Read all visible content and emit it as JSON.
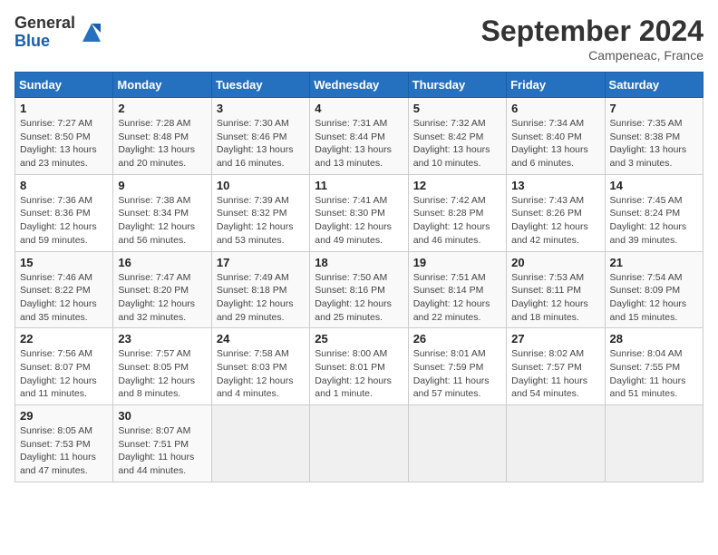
{
  "header": {
    "logo_general": "General",
    "logo_blue": "Blue",
    "month_title": "September 2024",
    "location": "Campeneac, France"
  },
  "calendar": {
    "days_of_week": [
      "Sunday",
      "Monday",
      "Tuesday",
      "Wednesday",
      "Thursday",
      "Friday",
      "Saturday"
    ],
    "weeks": [
      [
        {
          "day": "",
          "info": ""
        },
        {
          "day": "2",
          "info": "Sunrise: 7:28 AM\nSunset: 8:48 PM\nDaylight: 13 hours\nand 20 minutes."
        },
        {
          "day": "3",
          "info": "Sunrise: 7:30 AM\nSunset: 8:46 PM\nDaylight: 13 hours\nand 16 minutes."
        },
        {
          "day": "4",
          "info": "Sunrise: 7:31 AM\nSunset: 8:44 PM\nDaylight: 13 hours\nand 13 minutes."
        },
        {
          "day": "5",
          "info": "Sunrise: 7:32 AM\nSunset: 8:42 PM\nDaylight: 13 hours\nand 10 minutes."
        },
        {
          "day": "6",
          "info": "Sunrise: 7:34 AM\nSunset: 8:40 PM\nDaylight: 13 hours\nand 6 minutes."
        },
        {
          "day": "7",
          "info": "Sunrise: 7:35 AM\nSunset: 8:38 PM\nDaylight: 13 hours\nand 3 minutes."
        }
      ],
      [
        {
          "day": "1",
          "info": "Sunrise: 7:27 AM\nSunset: 8:50 PM\nDaylight: 13 hours\nand 23 minutes."
        },
        {
          "day": "9",
          "info": "Sunrise: 7:38 AM\nSunset: 8:34 PM\nDaylight: 12 hours\nand 56 minutes."
        },
        {
          "day": "10",
          "info": "Sunrise: 7:39 AM\nSunset: 8:32 PM\nDaylight: 12 hours\nand 53 minutes."
        },
        {
          "day": "11",
          "info": "Sunrise: 7:41 AM\nSunset: 8:30 PM\nDaylight: 12 hours\nand 49 minutes."
        },
        {
          "day": "12",
          "info": "Sunrise: 7:42 AM\nSunset: 8:28 PM\nDaylight: 12 hours\nand 46 minutes."
        },
        {
          "day": "13",
          "info": "Sunrise: 7:43 AM\nSunset: 8:26 PM\nDaylight: 12 hours\nand 42 minutes."
        },
        {
          "day": "14",
          "info": "Sunrise: 7:45 AM\nSunset: 8:24 PM\nDaylight: 12 hours\nand 39 minutes."
        }
      ],
      [
        {
          "day": "8",
          "info": "Sunrise: 7:36 AM\nSunset: 8:36 PM\nDaylight: 12 hours\nand 59 minutes."
        },
        {
          "day": "16",
          "info": "Sunrise: 7:47 AM\nSunset: 8:20 PM\nDaylight: 12 hours\nand 32 minutes."
        },
        {
          "day": "17",
          "info": "Sunrise: 7:49 AM\nSunset: 8:18 PM\nDaylight: 12 hours\nand 29 minutes."
        },
        {
          "day": "18",
          "info": "Sunrise: 7:50 AM\nSunset: 8:16 PM\nDaylight: 12 hours\nand 25 minutes."
        },
        {
          "day": "19",
          "info": "Sunrise: 7:51 AM\nSunset: 8:14 PM\nDaylight: 12 hours\nand 22 minutes."
        },
        {
          "day": "20",
          "info": "Sunrise: 7:53 AM\nSunset: 8:11 PM\nDaylight: 12 hours\nand 18 minutes."
        },
        {
          "day": "21",
          "info": "Sunrise: 7:54 AM\nSunset: 8:09 PM\nDaylight: 12 hours\nand 15 minutes."
        }
      ],
      [
        {
          "day": "15",
          "info": "Sunrise: 7:46 AM\nSunset: 8:22 PM\nDaylight: 12 hours\nand 35 minutes."
        },
        {
          "day": "23",
          "info": "Sunrise: 7:57 AM\nSunset: 8:05 PM\nDaylight: 12 hours\nand 8 minutes."
        },
        {
          "day": "24",
          "info": "Sunrise: 7:58 AM\nSunset: 8:03 PM\nDaylight: 12 hours\nand 4 minutes."
        },
        {
          "day": "25",
          "info": "Sunrise: 8:00 AM\nSunset: 8:01 PM\nDaylight: 12 hours\nand 1 minute."
        },
        {
          "day": "26",
          "info": "Sunrise: 8:01 AM\nSunset: 7:59 PM\nDaylight: 11 hours\nand 57 minutes."
        },
        {
          "day": "27",
          "info": "Sunrise: 8:02 AM\nSunset: 7:57 PM\nDaylight: 11 hours\nand 54 minutes."
        },
        {
          "day": "28",
          "info": "Sunrise: 8:04 AM\nSunset: 7:55 PM\nDaylight: 11 hours\nand 51 minutes."
        }
      ],
      [
        {
          "day": "22",
          "info": "Sunrise: 7:56 AM\nSunset: 8:07 PM\nDaylight: 12 hours\nand 11 minutes."
        },
        {
          "day": "30",
          "info": "Sunrise: 8:07 AM\nSunset: 7:51 PM\nDaylight: 11 hours\nand 44 minutes."
        },
        {
          "day": "",
          "info": ""
        },
        {
          "day": "",
          "info": ""
        },
        {
          "day": "",
          "info": ""
        },
        {
          "day": "",
          "info": ""
        },
        {
          "day": "",
          "info": ""
        }
      ],
      [
        {
          "day": "29",
          "info": "Sunrise: 8:05 AM\nSunset: 7:53 PM\nDaylight: 11 hours\nand 47 minutes."
        },
        {
          "day": "",
          "info": ""
        },
        {
          "day": "",
          "info": ""
        },
        {
          "day": "",
          "info": ""
        },
        {
          "day": "",
          "info": ""
        },
        {
          "day": "",
          "info": ""
        },
        {
          "day": "",
          "info": ""
        }
      ]
    ]
  }
}
